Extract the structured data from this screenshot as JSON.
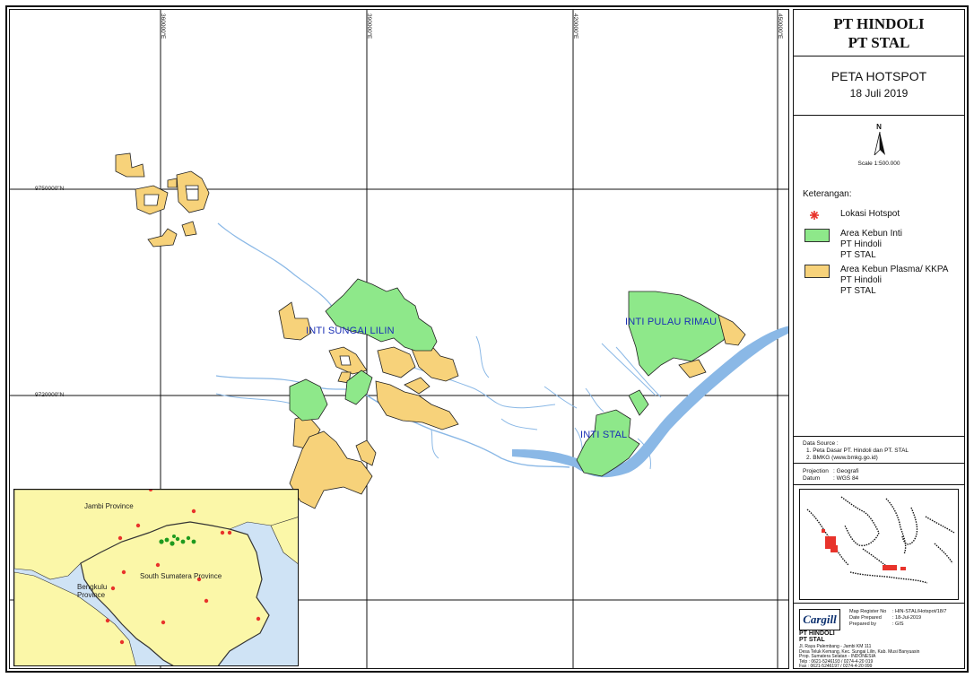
{
  "header": {
    "line1": "PT HINDOLI",
    "line2": "PT STAL"
  },
  "map_title": {
    "title": "PETA HOTSPOT",
    "date": "18 Juli 2019"
  },
  "north": {
    "letter": "N",
    "scale": "Scale 1:500.000"
  },
  "legend": {
    "heading": "Keterangan:",
    "items": [
      {
        "label": "Lokasi Hotspot",
        "color": "#e8332b"
      },
      {
        "label": "Area Kebun Inti",
        "sub1": "PT Hindoli",
        "sub2": "PT STAL",
        "color": "#8ee88a"
      },
      {
        "label": "Area Kebun Plasma/ KKPA",
        "sub1": "PT Hindoli",
        "sub2": "PT STAL",
        "color": "#f7d27a"
      }
    ]
  },
  "source": {
    "heading": "Data Source :",
    "line1": "1. Peta Dasar PT. Hindoli dan PT. STAL",
    "line2": "2. BMKG (www.bmkg.go.id)"
  },
  "projection": {
    "proj_label": "Projection",
    "proj_value": ": Geografi",
    "datum_label": "Datum",
    "datum_value": ": WGS 84"
  },
  "footer": {
    "logo": "Cargill",
    "company1": "PT HINDOLI",
    "company2": "PT STAL",
    "meta": [
      {
        "k": "Map Register No",
        "v": ": HIN-STAL/Hotspot/18/7"
      },
      {
        "k": "Date Prepared",
        "v": ": 18-Jul-2019"
      },
      {
        "k": "Prepared by",
        "v": ": GIS"
      }
    ],
    "address1": "Jl. Raya Palembang - Jambi KM 111",
    "address2": "Desa Teluk Kemang, Kec. Sungai Lilin, Kab. Musi Banyuasin",
    "address3": "Prop. Sumatera Selatan - INDONESIA",
    "telp": "Telp : 0621-5246193 / 0274-4-20 019",
    "fax": "Fax : 0621-5246197 / 0274-4-20 099"
  },
  "map": {
    "labels": {
      "sungai_lilin": "INTI  SUNGAI LILIN",
      "pulau_rimau": "INTI PULAU RIMAU",
      "stal": "INTI STAL"
    },
    "lon_ticks": [
      "360000\"E",
      "390000\"E",
      "420000\"E",
      "450000\"E"
    ],
    "lat_ticks": [
      "9750000\"N",
      "9720000\"N"
    ]
  },
  "inset": {
    "jambi": "Jambi Province",
    "south_sumatera": "South Sumatera Province",
    "bengkulu": "Bengkulu Province"
  },
  "colors": {
    "inti": "#8ee88a",
    "plasma": "#f7d27a",
    "river": "#8ab8e6",
    "hotspot": "#e8332b",
    "inset_land": "#fbf7a8"
  }
}
